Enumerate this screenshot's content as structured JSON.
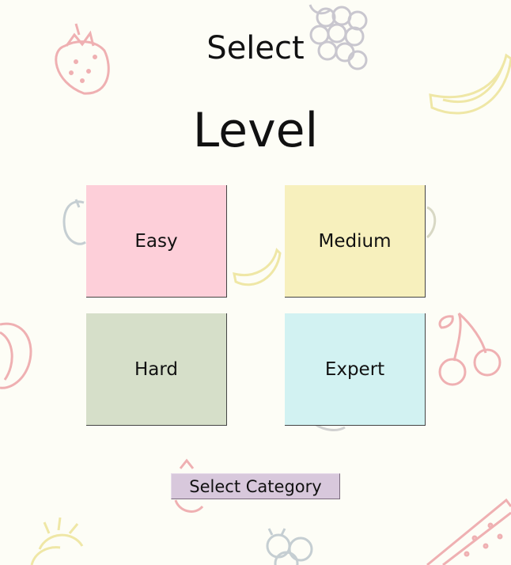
{
  "header": {
    "line1": "Select",
    "line2": "Level"
  },
  "levels": [
    {
      "label": "Easy",
      "color": "#fdcfd9"
    },
    {
      "label": "Medium",
      "color": "#f7f0bd"
    },
    {
      "label": "Hard",
      "color": "#d6dfc9"
    },
    {
      "label": "Expert",
      "color": "#d2f2f2"
    }
  ],
  "footer": {
    "category_button": "Select Category"
  },
  "background_icons": [
    "strawberry-icon",
    "grapes-icon",
    "banana-icon",
    "apple-icon",
    "pear-icon",
    "cherry-icon",
    "peach-icon",
    "pineapple-icon",
    "blueberry-icon",
    "watermelon-icon"
  ]
}
